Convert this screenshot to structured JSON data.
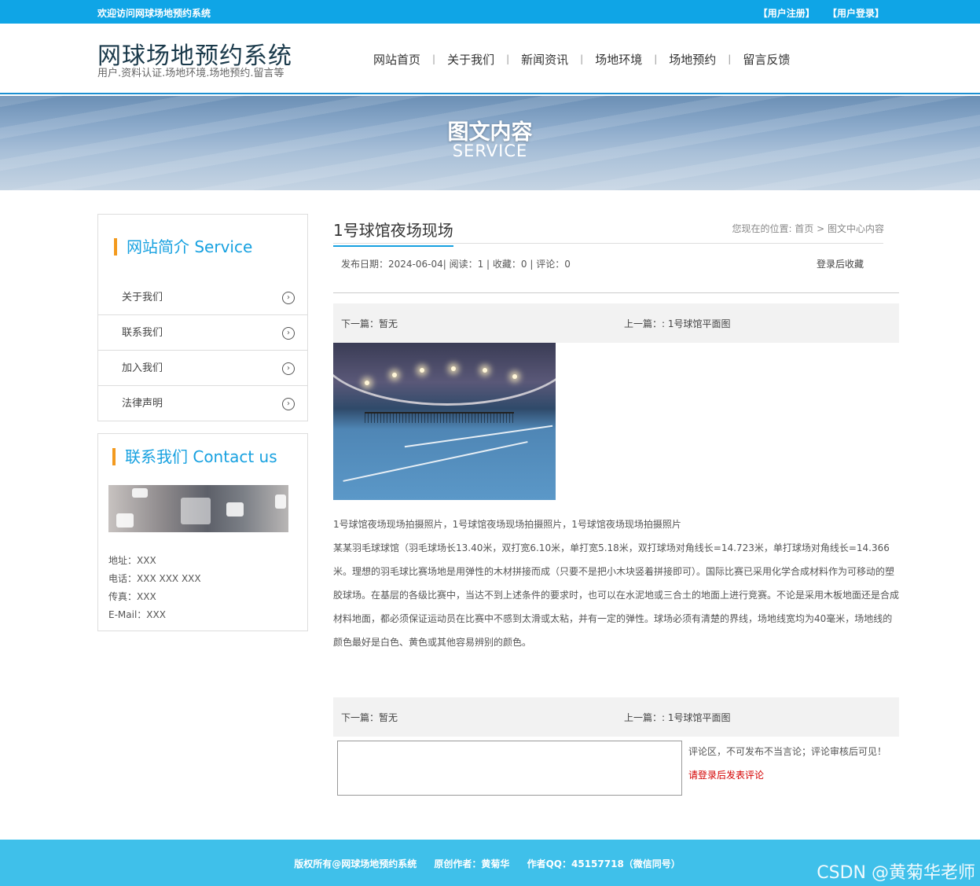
{
  "topbar": {
    "welcome": "欢迎访问网球场地预约系统",
    "register": "【用户注册】",
    "login": "【用户登录】"
  },
  "header": {
    "title": "网球场地预约系统",
    "subtitle": "用户.资料认证.场地环境.场地预约.留言等",
    "nav": [
      "网站首页",
      "关于我们",
      "新闻资讯",
      "场地环境",
      "场地预约",
      "留言反馈"
    ]
  },
  "banner": {
    "title": "图文内容",
    "subtitle": "SERVICE"
  },
  "sidebar": {
    "intro_title": "网站简介 Service",
    "menu": [
      "关于我们",
      "联系我们",
      "加入我们",
      "法律声明"
    ],
    "contact_title": "联系我们 Contact us",
    "contact": [
      "地址：XXX",
      "电话：XXX XXX XXX",
      "传真：XXX",
      "E-Mail：XXX"
    ]
  },
  "article": {
    "title": "1号球馆夜场现场",
    "breadcrumb": "您现在的位置:   首页  >  图文中心内容",
    "meta": "发布日期：2024-06-04|    阅读：1  |     收藏：0  |     评论：0",
    "favorite": "登录后收藏",
    "next": "下一篇：暂无",
    "prev": "上一篇：: 1号球馆平面图",
    "paragraphs": [
      "1号球馆夜场现场拍摄照片，1号球馆夜场现场拍摄照片，1号球馆夜场现场拍摄照片",
      "某某羽毛球球馆（羽毛球场长13.40米，双打宽6.10米，单打宽5.18米，双打球场对角线长=14.723米，单打球场对角线长=14.366米。理想的羽毛球比赛场地是用弹性的木材拼接而成（只要不是把小木块竖着拼接即可）。国际比赛已采用化学合成材料作为可移动的塑胶球场。在基层的各级比赛中，当达不到上述条件的要求时，也可以在水泥地或三合土的地面上进行竞赛。不论是采用木板地面还是合成材料地面，都必须保证运动员在比赛中不感到太滑或太粘，并有一定的弹性。球场必须有清楚的界线，场地线宽均为40毫米，场地线的颜色最好是白色、黄色或其他容易辨别的颜色。"
    ]
  },
  "comment": {
    "tip": "评论区，不可发布不当言论；评论审核后可见！",
    "login_tip": "请登录后发表评论"
  },
  "footer": {
    "copyright": "版权所有@网球场地预约系统",
    "author": "原创作者：黄菊华",
    "qq": "作者QQ：45157718（微信同号）"
  },
  "watermark": "CSDN @黄菊华老师",
  "colors": {
    "accent": "#0fa5e6",
    "footer": "#3fc0ea",
    "marker": "#f39a1e",
    "warn": "#d40000"
  }
}
